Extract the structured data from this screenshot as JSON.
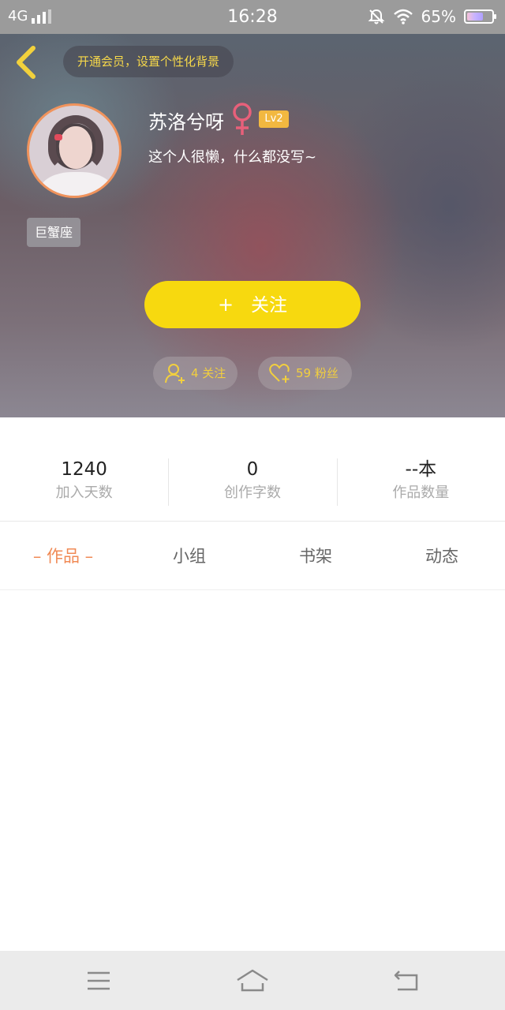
{
  "status_bar": {
    "network": "4G",
    "time": "16:28",
    "battery": "65%",
    "battery_level": 0.65
  },
  "header": {
    "vip_prompt": "开通会员，设置个性化背景",
    "username": "苏洛兮呀",
    "level": "Lv2",
    "bio": "这个人很懒，什么都没写~",
    "zodiac": "巨蟹座",
    "follow_plus": "+",
    "follow_label": "关注",
    "following_count": "4 关注",
    "fans_count": "59 粉丝"
  },
  "metrics": [
    {
      "value": "1240",
      "label": "加入天数"
    },
    {
      "value": "0",
      "label": "创作字数"
    },
    {
      "value": "--本",
      "label": "作品数量"
    }
  ],
  "tabs": [
    {
      "label": "– 作品 –",
      "active": true
    },
    {
      "label": "小组",
      "active": false
    },
    {
      "label": "书架",
      "active": false
    },
    {
      "label": "动态",
      "active": false
    }
  ],
  "colors": {
    "accent_yellow": "#f7d90f",
    "accent_orange": "#f08a55",
    "level_badge": "#f2b840",
    "pill_text": "#f2cf3e"
  },
  "icons": {
    "back": "chevron-left-icon",
    "gender": "female-icon",
    "following": "user-plus-icon",
    "fans": "heart-plus-icon",
    "nav_menu": "menu-icon",
    "nav_home": "home-icon",
    "nav_back": "return-icon"
  }
}
